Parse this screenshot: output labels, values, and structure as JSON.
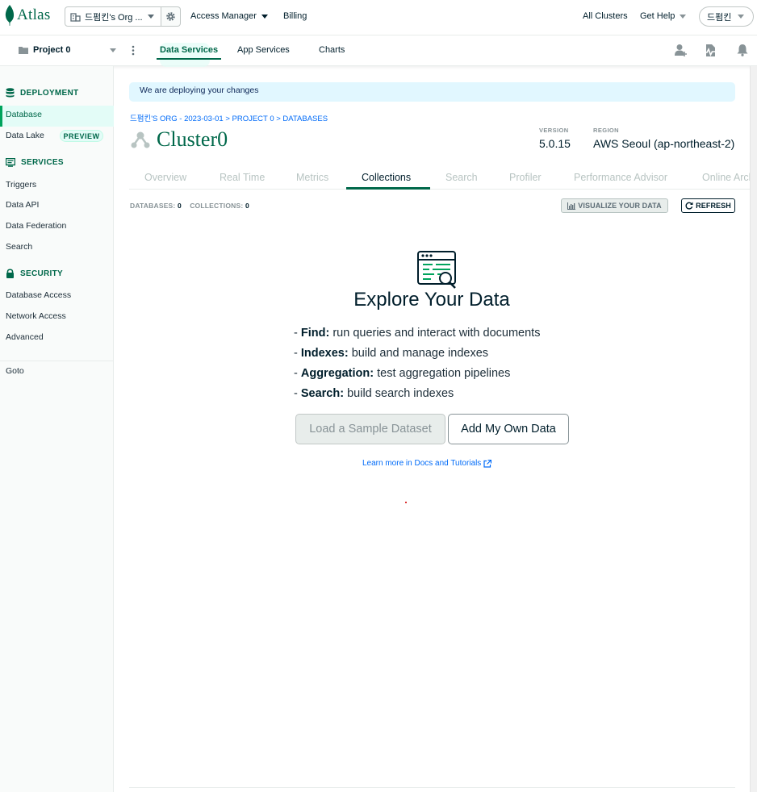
{
  "topbar": {
    "logo_text": "Atlas",
    "org_name": "드펌킨's Org ...",
    "access_manager": "Access Manager",
    "billing": "Billing",
    "all_clusters": "All Clusters",
    "get_help": "Get Help",
    "user_name": "드펌킨"
  },
  "projectbar": {
    "project_name": "Project 0",
    "tabs": [
      {
        "label": "Data Services",
        "active": true
      },
      {
        "label": "App Services",
        "active": false
      },
      {
        "label": "Charts",
        "active": false
      }
    ]
  },
  "sidebar": {
    "deployment_header": "DEPLOYMENT",
    "database": "Database",
    "data_lake": "Data Lake",
    "preview_badge": "PREVIEW",
    "services_header": "SERVICES",
    "triggers": "Triggers",
    "data_api": "Data API",
    "data_federation": "Data Federation",
    "search": "Search",
    "security_header": "SECURITY",
    "database_access": "Database Access",
    "network_access": "Network Access",
    "advanced": "Advanced",
    "goto": "Goto"
  },
  "main": {
    "banner": "We are deploying your changes",
    "breadcrumb": "드펌킨'S ORG - 2023-03-01 > PROJECT 0 > DATABASES",
    "cluster_name": "Cluster0",
    "version_label": "VERSION",
    "version_value": "5.0.15",
    "region_label": "REGION",
    "region_value": "AWS Seoul (ap-northeast-2)",
    "tabs": [
      "Overview",
      "Real Time",
      "Metrics",
      "Collections",
      "Search",
      "Profiler",
      "Performance Advisor",
      "Online Archive"
    ],
    "active_tab": "Collections",
    "databases_label": "DATABASES:",
    "databases_count": "0",
    "collections_label": "COLLECTIONS:",
    "collections_count": "0",
    "visualize_button": "VISUALIZE YOUR DATA",
    "refresh_button": "REFRESH",
    "explore_title": "Explore Your Data",
    "features": [
      {
        "term": "Find:",
        "desc": "run queries and interact with documents"
      },
      {
        "term": "Indexes:",
        "desc": "build and manage indexes"
      },
      {
        "term": "Aggregation:",
        "desc": "test aggregation pipelines"
      },
      {
        "term": "Search:",
        "desc": "build search indexes"
      }
    ],
    "load_sample_button": "Load a Sample Dataset",
    "add_own_button": "Add My Own Data",
    "learn_more": "Learn more in Docs and Tutorials"
  },
  "colors": {
    "brand_green": "#00684a",
    "link_blue": "#016bf8",
    "banner_bg": "#e1f7ff"
  }
}
